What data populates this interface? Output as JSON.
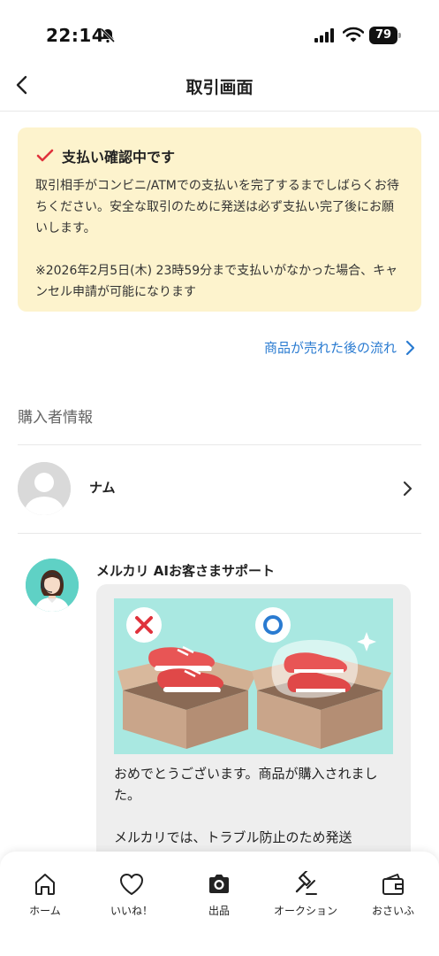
{
  "status_bar": {
    "time": "22:14",
    "battery": "79"
  },
  "header": {
    "title": "取引画面"
  },
  "notice": {
    "title": "支払い確認中です",
    "body": "取引相手がコンビニ/ATMでの支払いを完了するまでしばらくお待ちください。安全な取引のために発送は必ず支払い完了後にお願いします。",
    "note": "※2026年2月5日(木) 23時59分まで支払いがなかった場合、キャンセル申請が可能になります"
  },
  "flow_link": {
    "label": "商品が売れた後の流れ"
  },
  "buyer": {
    "heading": "購入者情報",
    "name": "ナム"
  },
  "support": {
    "name": "メルカリ AIお客さまサポート",
    "message_1": "おめでとうございます。商品が購入されました。",
    "message_2": "メルカリでは、トラブル防止のため発送"
  },
  "tabs": [
    {
      "label": "ホーム",
      "icon": "home-icon"
    },
    {
      "label": "いいね！",
      "icon": "heart-icon"
    },
    {
      "label": "出品",
      "icon": "camera-icon"
    },
    {
      "label": "オークション",
      "icon": "gavel-icon"
    },
    {
      "label": "おさいふ",
      "icon": "wallet-icon"
    }
  ],
  "colors": {
    "notice_bg": "#fdf3cd",
    "check": "#e0323c",
    "link": "#2a7bd1",
    "illustration_bg": "#a9e8e1"
  }
}
